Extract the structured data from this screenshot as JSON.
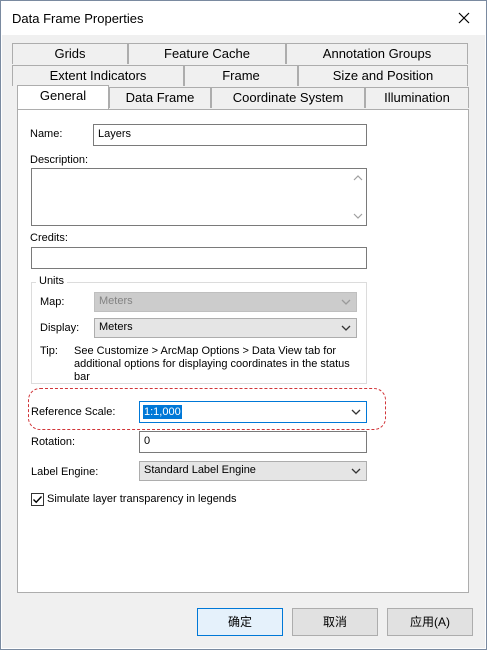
{
  "window": {
    "title": "Data Frame Properties"
  },
  "tabs": {
    "row1": [
      "Grids",
      "Feature Cache",
      "Annotation Groups"
    ],
    "row2": [
      "Extent Indicators",
      "Frame",
      "Size and Position"
    ],
    "row3": [
      "General",
      "Data Frame",
      "Coordinate System",
      "Illumination"
    ],
    "active": "General"
  },
  "general": {
    "name_label": "Name:",
    "name_value": "Layers",
    "description_label": "Description:",
    "description_value": "",
    "credits_label": "Credits:",
    "credits_value": "",
    "units": {
      "title": "Units",
      "map_label": "Map:",
      "map_value": "Meters",
      "display_label": "Display:",
      "display_value": "Meters",
      "tip_label": "Tip:",
      "tip_text_line1": "See Customize > ArcMap Options > Data View tab for",
      "tip_text_line2": "additional options for displaying coordinates in the status",
      "tip_text_line3": "bar"
    },
    "reference_scale_label": "Reference Scale:",
    "reference_scale_value": "1:1,000",
    "rotation_label": "Rotation:",
    "rotation_value": "0",
    "label_engine_label": "Label Engine:",
    "label_engine_value": "Standard Label Engine",
    "simulate_transparency_label": "Simulate layer transparency in legends",
    "simulate_transparency_checked": true
  },
  "buttons": {
    "ok": "确定",
    "cancel": "取消",
    "apply": "应用(A)"
  },
  "colors": {
    "accent": "#0078d7",
    "highlight": "#d13438"
  }
}
